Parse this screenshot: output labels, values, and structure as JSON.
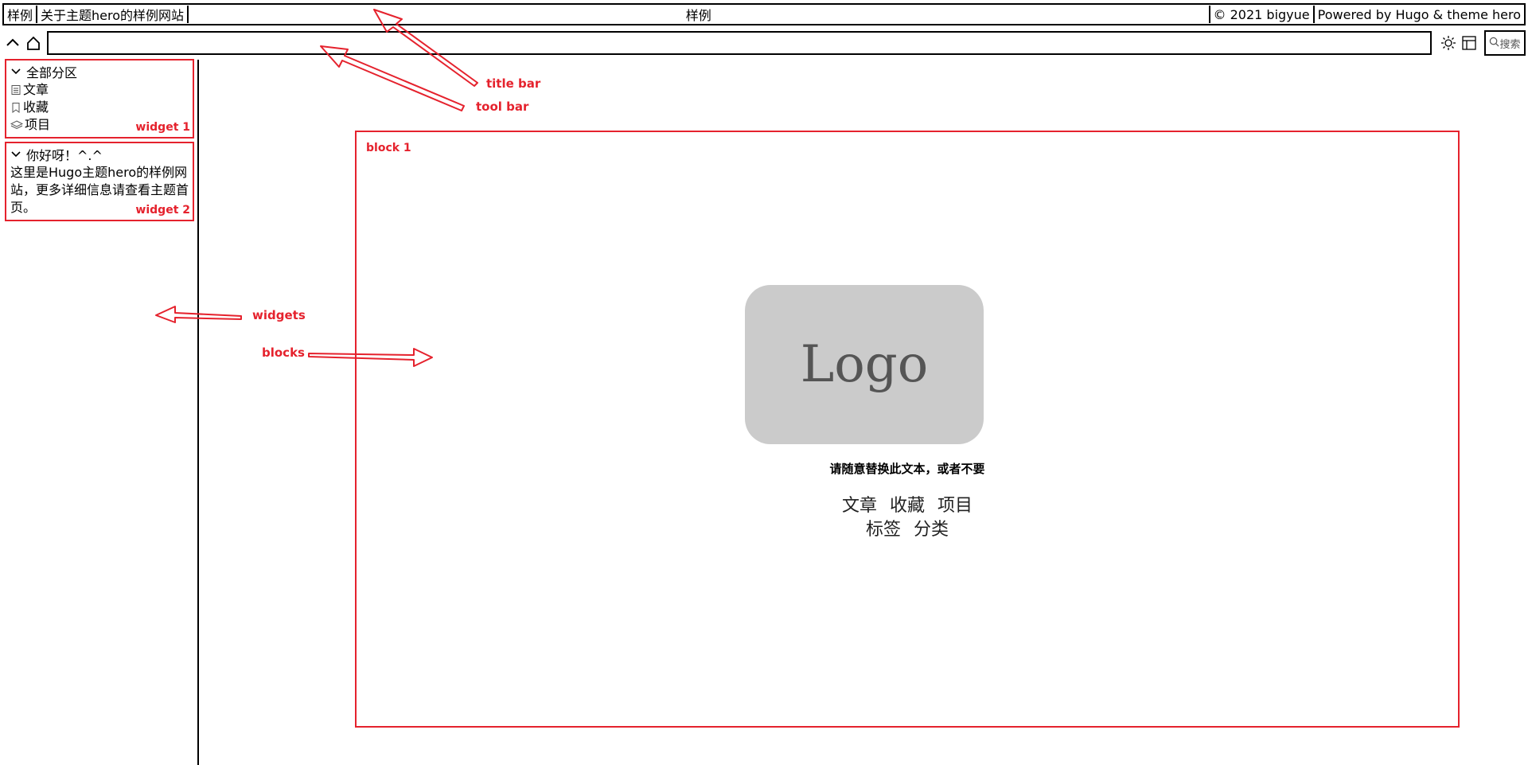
{
  "titlebar": {
    "left_items": [
      "样例",
      "关于主题hero的样例网站"
    ],
    "center_title": "样例",
    "right_items": [
      "© 2021 bigyue",
      "Powered by Hugo & theme hero"
    ]
  },
  "toolbar": {
    "address_value": "",
    "search_label": "搜索",
    "icons": [
      "chevron-up-icon",
      "home-icon",
      "sun-icon",
      "layout-icon",
      "search-icon"
    ]
  },
  "sidebar": {
    "widget1": {
      "title": "全部分区",
      "items": [
        {
          "label": "文章",
          "icon": "document-icon"
        },
        {
          "label": "收藏",
          "icon": "bookmark-icon"
        },
        {
          "label": "项目",
          "icon": "layers-icon"
        }
      ],
      "tag": "widget 1"
    },
    "widget2": {
      "title": "你好呀！^.^",
      "text": "这里是Hugo主题hero的样例网站，更多详细信息请查看主题首页。",
      "tag": "widget 2"
    }
  },
  "block": {
    "tag": "block 1",
    "logo_text": "Logo",
    "tagline": "请随意替换此文本，或者不要",
    "links_row1": [
      "文章",
      "收藏",
      "项目"
    ],
    "links_row2": [
      "标签",
      "分类"
    ]
  },
  "annotations": {
    "title_bar": "title bar",
    "tool_bar": "tool bar",
    "widgets": "widgets",
    "blocks": "blocks"
  },
  "colors": {
    "annotation": "#e5222d",
    "logo_bg": "#cbcbcb"
  }
}
